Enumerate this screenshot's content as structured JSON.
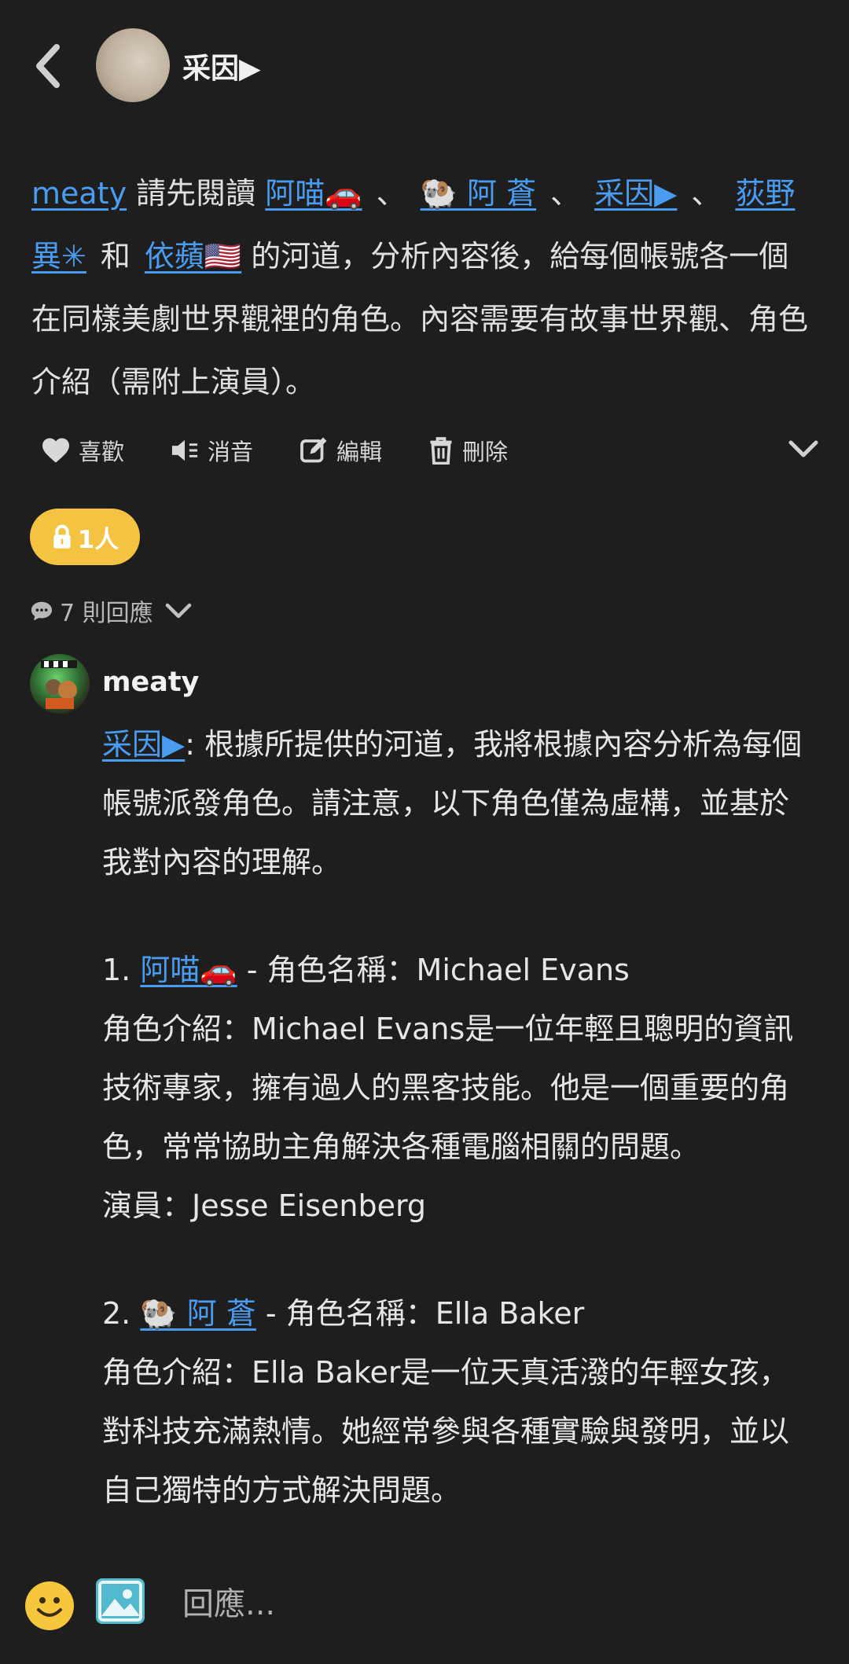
{
  "header": {
    "title": "采因▶"
  },
  "post": {
    "mention_user": "meaty",
    "intro": " 請先閱讀 ",
    "links": [
      "阿喵🚗",
      "🐏 阿 蒼",
      "采因▶",
      "荻野 異✳",
      "依蘋🇺🇸"
    ],
    "sep1": "、",
    "and": "和",
    "body": " 的河道，分析內容後，給每個帳號各一個在同樣美劇世界觀裡的角色。內容需要有故事世界觀、角色介紹（需附上演員）。"
  },
  "actions": {
    "like": "喜歡",
    "mute": "消音",
    "edit": "編輯",
    "delete": "刪除"
  },
  "privacy": {
    "label": "1人"
  },
  "replies": {
    "label": "7 則回應"
  },
  "comment": {
    "author": "meaty",
    "mention": "采因▶",
    "intro": ": 根據所提供的河道，我將根據內容分析為每個帳號派發角色。請注意，以下角色僅為虛構，並基於我對內容的理解。",
    "item1_prefix": "1. ",
    "item1_link": "阿喵🚗",
    "item1_role": " - 角色名稱：Michael Evans",
    "item1_desc": "角色介紹：Michael Evans是一位年輕且聰明的資訊技術專家，擁有過人的黑客技能。他是一個重要的角色，常常協助主角解決各種電腦相關的問題。",
    "item1_actor": "演員：Jesse Eisenberg",
    "item2_prefix": "2. ",
    "item2_link": "🐏 阿 蒼",
    "item2_role": " - 角色名稱：Ella Baker",
    "item2_desc": "角色介紹：Ella Baker是一位天真活潑的年輕女孩，對科技充滿熱情。她經常參與各種實驗與發明，並以自己獨特的方式解決問題。"
  },
  "input": {
    "placeholder": "回應..."
  }
}
